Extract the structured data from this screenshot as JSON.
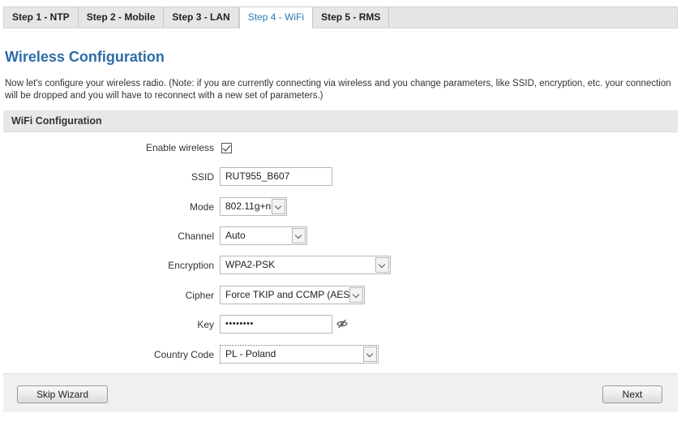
{
  "tabs": [
    {
      "label": "Step 1 - NTP"
    },
    {
      "label": "Step 2 - Mobile"
    },
    {
      "label": "Step 3 - LAN"
    },
    {
      "label": "Step 4 - WiFi"
    },
    {
      "label": "Step 5 - RMS"
    }
  ],
  "active_tab": "Step 4 - WiFi",
  "page": {
    "title": "Wireless Configuration",
    "description": "Now let's configure your wireless radio. (Note: if you are currently connecting via wireless and you change parameters, like SSID, encryption, etc. your connection will be dropped and you will have to reconnect with a new set of parameters.)"
  },
  "section": {
    "title": "WiFi Configuration"
  },
  "form": {
    "enable_wireless": {
      "label": "Enable wireless",
      "checked": true
    },
    "ssid": {
      "label": "SSID",
      "value": "RUT955_B607"
    },
    "mode": {
      "label": "Mode",
      "value": "802.11g+n"
    },
    "channel": {
      "label": "Channel",
      "value": "Auto"
    },
    "encryption": {
      "label": "Encryption",
      "value": "WPA2-PSK"
    },
    "cipher": {
      "label": "Cipher",
      "value": "Force TKIP and CCMP (AES)"
    },
    "key": {
      "label": "Key",
      "value": "••••••••"
    },
    "country_code": {
      "label": "Country Code",
      "value": "PL - Poland"
    }
  },
  "icons": {
    "password_toggle": "eye-slash-icon",
    "dropdown": "chevron-down-icon"
  },
  "footer": {
    "skip_label": "Skip Wizard",
    "next_label": "Next"
  },
  "colors": {
    "accent": "#2d6ca8",
    "active_tab": "#2a7ab8"
  }
}
